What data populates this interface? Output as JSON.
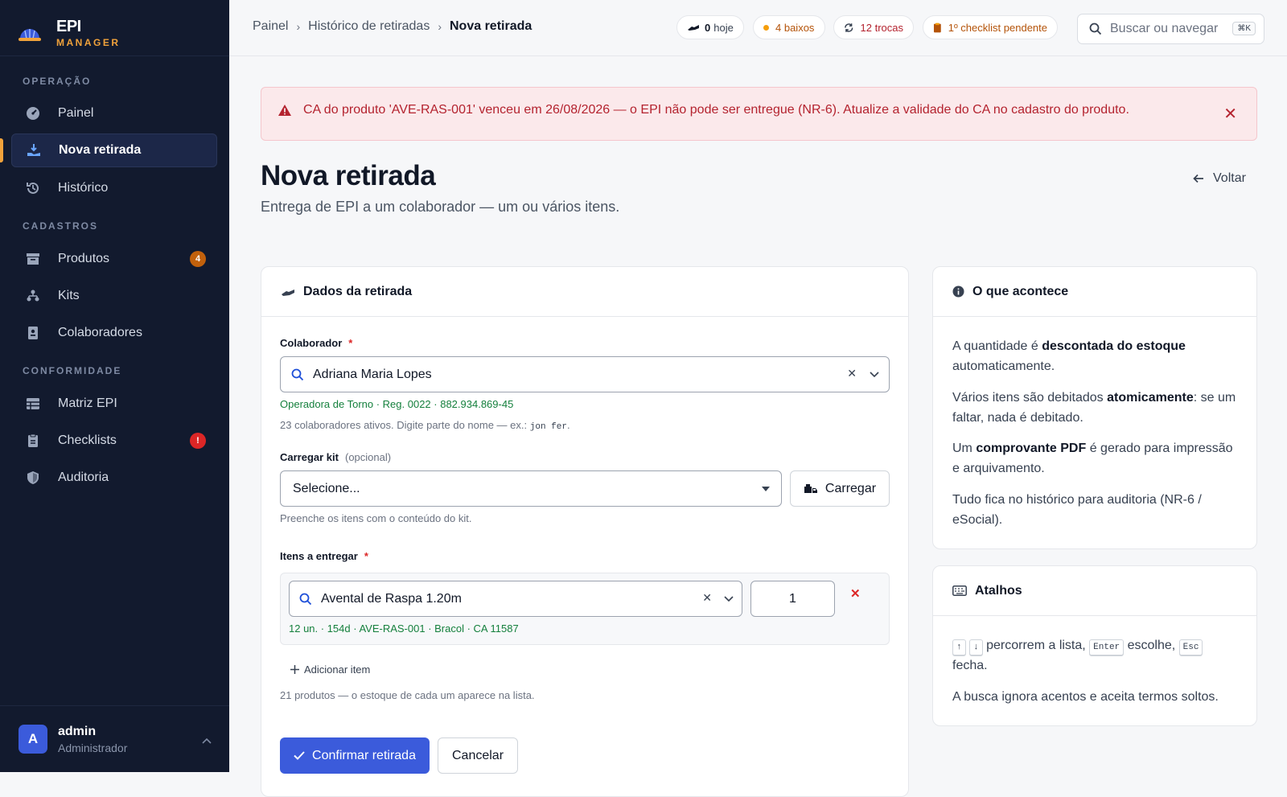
{
  "brand": {
    "name": "EPI",
    "tagline": "MANAGER"
  },
  "sidebar": {
    "sections": [
      {
        "title": "OPERAÇÃO"
      },
      {
        "title": "CADASTROS"
      },
      {
        "title": "CONFORMIDADE"
      }
    ],
    "items": [
      {
        "label": "Painel",
        "icon": "dashboard-icon"
      },
      {
        "label": "Nova retirada",
        "icon": "handover-icon",
        "active": true
      },
      {
        "label": "Histórico",
        "icon": "history-icon"
      },
      {
        "label": "Produtos",
        "icon": "archive-icon",
        "badge": "4"
      },
      {
        "label": "Kits",
        "icon": "sitemap-icon"
      },
      {
        "label": "Colaboradores",
        "icon": "badge-icon"
      },
      {
        "label": "Matriz EPI",
        "icon": "table-icon"
      },
      {
        "label": "Checklists",
        "icon": "clipboard-icon",
        "badge": "!"
      },
      {
        "label": "Auditoria",
        "icon": "shield-icon"
      }
    ],
    "user": {
      "initial": "A",
      "name": "admin",
      "role": "Administrador"
    }
  },
  "topbar": {
    "breadcrumb": [
      "Painel",
      "Histórico de retiradas",
      "Nova retirada"
    ],
    "pills": [
      {
        "count": "0",
        "label": "hoje"
      },
      {
        "label": "4 baixos"
      },
      {
        "label": "12 trocas"
      },
      {
        "label": "1º checklist pendente"
      }
    ],
    "search": {
      "placeholder": "Buscar ou navegar",
      "shortcut": "⌘K"
    }
  },
  "alert": {
    "message": "CA do produto 'AVE-RAS-001' venceu em 26/08/2026 — o EPI não pode ser entregue (NR-6). Atualize a validade do CA no cadastro do produto."
  },
  "page": {
    "title": "Nova retirada",
    "subtitle": "Entrega de EPI a um colaborador — um ou vários itens.",
    "back": "Voltar"
  },
  "form": {
    "card_title": "Dados da retirada",
    "colaborador": {
      "label": "Colaborador",
      "required": "*",
      "value": "Adriana Maria Lopes",
      "detail": "Operadora de Torno · Reg. 0022 · 882.934.869-45",
      "hint_prefix": "23 colaboradores ativos. Digite parte do nome — ex.:",
      "hint_example": "jon fer",
      "hint_suffix": "."
    },
    "kit": {
      "label": "Carregar kit",
      "optional": "(opcional)",
      "value": "Selecione...",
      "button": "Carregar",
      "hint": "Preenche os itens com o conteúdo do kit."
    },
    "itens": {
      "label": "Itens a entregar",
      "required": "*",
      "rows": [
        {
          "product": "Avental de Raspa 1.20m",
          "quantity": "1",
          "detail": "12 un. · 154d · AVE-RAS-001 · Bracol · CA 11587"
        }
      ],
      "add_label": "Adicionar item",
      "hint": "21 produtos — o estoque de cada um aparece na lista."
    },
    "confirm": "Confirmar retirada",
    "cancel": "Cancelar"
  },
  "info_card": {
    "title": "O que acontece",
    "p1_a": "A quantidade é ",
    "p1_b": "descontada do estoque",
    "p1_c": " automaticamente.",
    "p2_a": "Vários itens são debitados ",
    "p2_b": "atomicamente",
    "p2_c": ": se um faltar, nada é debitado.",
    "p3_a": "Um ",
    "p3_b": "comprovante PDF",
    "p3_c": " é gerado para impressão e arquivamento.",
    "p4": "Tudo fica no histórico para auditoria (NR-6 / eSocial)."
  },
  "shortcuts_card": {
    "title": "Atalhos",
    "key_up": "↑",
    "key_down": "↓",
    "t1": " percorrem a lista, ",
    "key_enter": "Enter",
    "t2": " escolhe, ",
    "key_esc": "Esc",
    "t3": " fecha.",
    "t4": "A busca ignora acentos e aceita termos soltos."
  },
  "colors": {
    "sidebar_bg": "#121a2e",
    "accent": "#3b5bdb",
    "brand": "#f0a23b",
    "danger": "#b4232f",
    "success": "#15803d"
  }
}
